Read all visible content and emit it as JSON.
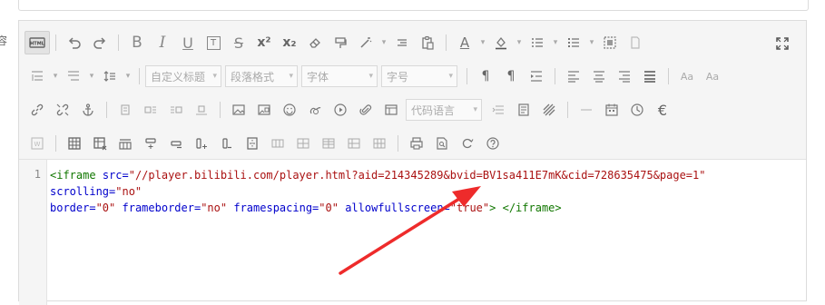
{
  "window": {
    "side_label": "容"
  },
  "toolbar": {
    "row1": [
      {
        "name": "html-source-button",
        "icon": "html-icon",
        "label": "HTML",
        "active": true
      },
      {
        "name": "undo-button",
        "icon": "undo-icon"
      },
      {
        "name": "redo-button",
        "icon": "redo-icon"
      },
      {
        "name": "bold-button",
        "icon": "bold-icon",
        "label": "B"
      },
      {
        "name": "italic-button",
        "icon": "italic-icon",
        "label": "I"
      },
      {
        "name": "underline-button",
        "icon": "underline-icon",
        "label": "U"
      },
      {
        "name": "text-border-button",
        "icon": "text-border-icon",
        "label": "T"
      },
      {
        "name": "strikethrough-button",
        "icon": "strikethrough-icon",
        "label": "S"
      },
      {
        "name": "superscript-button",
        "icon": "superscript-icon",
        "label": "x²"
      },
      {
        "name": "subscript-button",
        "icon": "subscript-icon",
        "label": "x₂"
      },
      {
        "name": "clear-format-button",
        "icon": "eraser-icon"
      },
      {
        "name": "format-painter-button",
        "icon": "format-painter-icon"
      },
      {
        "name": "auto-format-button",
        "icon": "magic-wand-icon"
      },
      {
        "name": "blockquote-button",
        "icon": "blockquote-icon"
      },
      {
        "name": "paste-text-button",
        "icon": "paste-icon"
      },
      {
        "name": "font-color-button",
        "icon": "font-color-icon",
        "label": "A"
      },
      {
        "name": "background-color-button",
        "icon": "fill-color-icon"
      },
      {
        "name": "ordered-list-button",
        "icon": "ordered-list-icon"
      },
      {
        "name": "unordered-list-button",
        "icon": "unordered-list-icon"
      },
      {
        "name": "select-all-button",
        "icon": "select-all-icon"
      },
      {
        "name": "clear-doc-button",
        "icon": "blank-doc-icon"
      }
    ],
    "fullscreen_icon": "fullscreen-icon",
    "row2": {
      "paragraph_style_placeholder": "自定义标题",
      "paragraph_format_placeholder": "段落格式",
      "font_family_placeholder": "字体",
      "font_size_placeholder": "字号"
    },
    "row3": {
      "code_language_placeholder": "代码语言"
    }
  },
  "editor": {
    "line_number": "1",
    "code": {
      "open_tag_start": "<iframe",
      "src_attr": "src=",
      "src_val": "\"//player.bilibili.com/player.html?aid=214345289&bvid=BV1sa411E7mK&cid=728635475&page=1\"",
      "scrolling_attr": "scrolling=",
      "scrolling_val": "\"no\"",
      "border_attr": "border=",
      "border_val": "\"0\"",
      "frameborder_attr": "frameborder=",
      "frameborder_val": "\"no\"",
      "framespacing_attr": "framespacing=",
      "framespacing_val": "\"0\"",
      "allowfullscreen_attr": "allowfullscreen=",
      "allowfullscreen_val": "\"true\"",
      "open_tag_end": ">",
      "close_tag": "</iframe>"
    }
  },
  "colors": {
    "tag": "#117700",
    "attribute": "#0000cc",
    "string": "#aa1111",
    "annotation_arrow": "#ee2b2b"
  }
}
